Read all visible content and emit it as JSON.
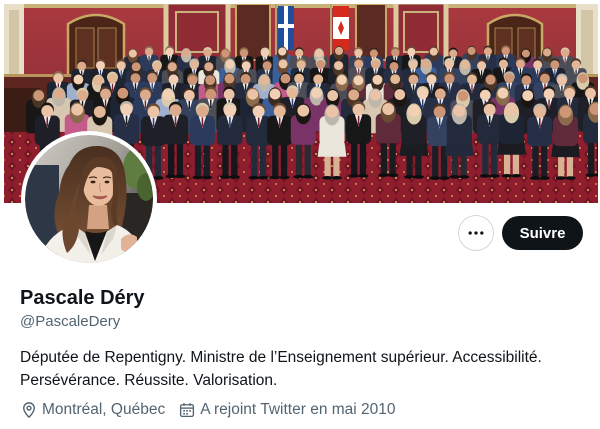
{
  "profile": {
    "name": "Pascale Déry",
    "handle": "@PascaleDery",
    "bio": "Députée de Repentigny. Ministre de l’Enseignement supérieur. Accessibilité. Persévérance. Réussite. Valorisation.",
    "location": "Montréal, Québec",
    "joined": "A rejoint Twitter en mai 2010"
  },
  "actions": {
    "follow_label": "Suivre",
    "more_icon": "more-horizontal-icon"
  },
  "icons": {
    "location": "location-pin-icon",
    "calendar": "calendar-icon"
  },
  "colors": {
    "text_primary": "#0f1419",
    "text_secondary": "#536471",
    "follow_button_bg": "#0f1419",
    "follow_button_text": "#ffffff",
    "button_border": "#cfd9de"
  }
}
